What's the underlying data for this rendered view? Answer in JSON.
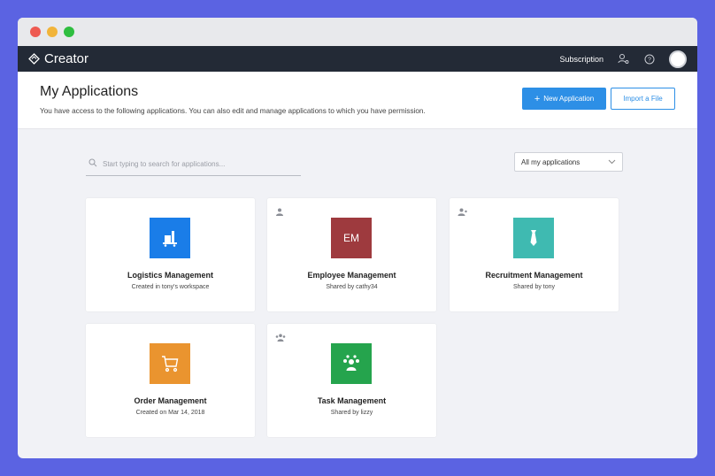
{
  "app": {
    "brand": "Creator"
  },
  "topbar": {
    "subscription": "Subscription"
  },
  "header": {
    "title": "My Applications",
    "subtitle": "You have access to the following applications. You can also edit and manage applications to which you have permission.",
    "new_button": "New Application",
    "new_button_prefix": "+",
    "import_button": "Import a File"
  },
  "search": {
    "placeholder": "Start typing to search for applications..."
  },
  "filter": {
    "selected": "All my applications"
  },
  "apps": [
    {
      "name": "Logistics Management",
      "meta": "Created in tony's workspace",
      "color": "#1a7de8",
      "icon": "logistics-icon",
      "shared": false
    },
    {
      "name": "Employee Management",
      "meta": "Shared by cathy34",
      "color": "#9e3a3e",
      "icon": "initials",
      "initials": "EM",
      "shared": true
    },
    {
      "name": "Recruitment Management",
      "meta": "Shared by tony",
      "color": "#3fbab1",
      "icon": "tie-icon",
      "shared": true
    },
    {
      "name": "Order Management",
      "meta": "Created on Mar 14, 2018",
      "color": "#ea942f",
      "icon": "cart-icon",
      "shared": false
    },
    {
      "name": "Task Management",
      "meta": "Shared by lizzy",
      "color": "#25a44d",
      "icon": "team-icon",
      "shared": true
    }
  ]
}
